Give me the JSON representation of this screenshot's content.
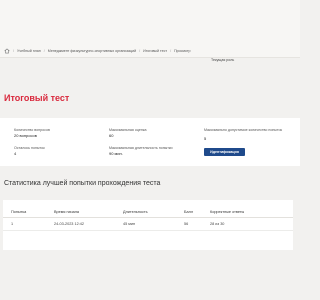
{
  "breadcrumb": {
    "items": [
      "Учебный план",
      "Менеджмент физкультурно-спортивных организаций",
      "Итоговый тест",
      "Просмотр"
    ],
    "separator": "/"
  },
  "role": "Текущая роль",
  "title": "Итоговый тест",
  "summary": {
    "questions_label": "Количество вопросов",
    "questions_value": "20 вопросов",
    "max_score_label": "Максимальная оценка",
    "max_score_value": "60",
    "max_attempts_label": "Максимально допустимое количество попыток",
    "max_attempts_value": "5",
    "remaining_label": "Осталось попыток",
    "remaining_value": "4",
    "max_duration_label": "Максимальная длительность попытки",
    "max_duration_value": "90 мин.",
    "ident_button": "Идентификация"
  },
  "stats_heading": "Статистика лучшей попытки прохождения теста",
  "table": {
    "headers": [
      "Попытка",
      "Время начала",
      "Длительность",
      "Балл",
      "Корректные ответы"
    ],
    "rows": [
      [
        "1",
        "24-03-2023 12:42",
        "45 мин",
        "56",
        "28 из 30"
      ]
    ]
  },
  "colors": {
    "accent": "#d9293d",
    "button": "#1f4a8b",
    "background": "#f2f1ef"
  },
  "icons": {
    "home": "home-icon"
  }
}
